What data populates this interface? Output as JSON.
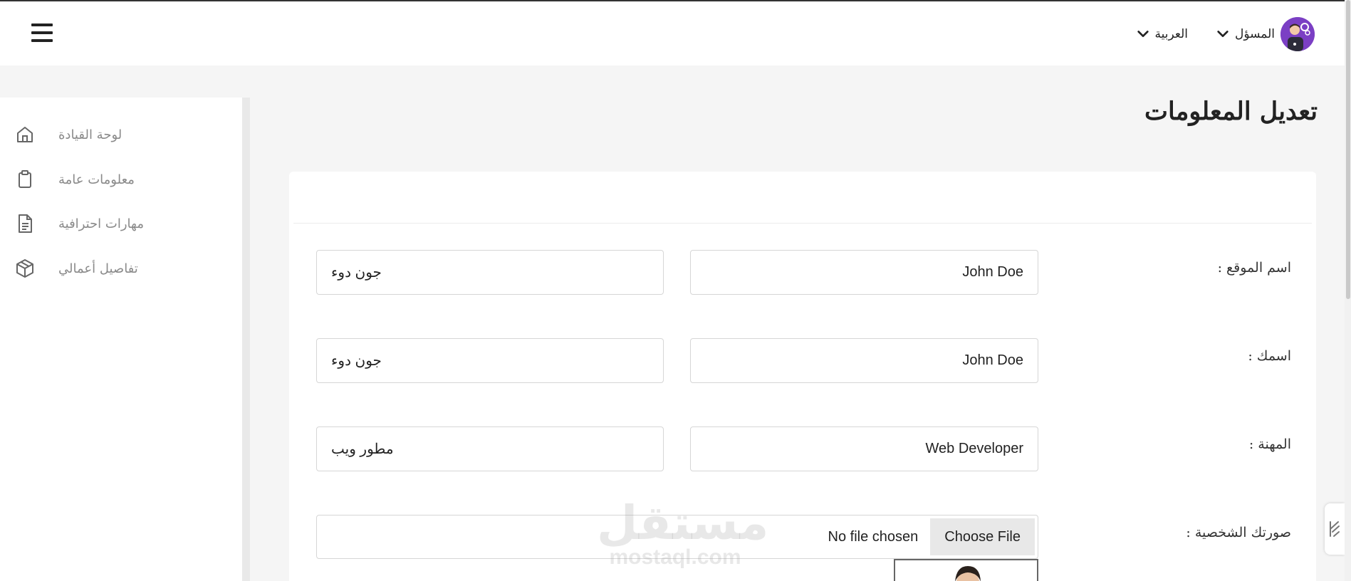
{
  "header": {
    "user_name": "المسؤل",
    "language": "العربية",
    "user_icon": "user-avatar",
    "menu_icon": "hamburger-menu-icon"
  },
  "sidebar": {
    "items": [
      {
        "label": "لوحة القيادة",
        "icon": "home-icon"
      },
      {
        "label": "معلومات عامة",
        "icon": "clipboard-icon"
      },
      {
        "label": "مهارات احترافية",
        "icon": "document-icon"
      },
      {
        "label": "تفاصيل أعمالي",
        "icon": "box-icon"
      }
    ]
  },
  "page": {
    "title": "تعديل المعلومات"
  },
  "form": {
    "site_name": {
      "label": "اسم الموقع :",
      "value_en": "John Doe",
      "value_ar": "جون دوء"
    },
    "your_name": {
      "label": "اسمك :",
      "value_en": "John Doe",
      "value_ar": "جون دوء"
    },
    "profession": {
      "label": "المهنة :",
      "value_en": "Web Developer",
      "value_ar": "مطور ويب"
    },
    "photo": {
      "label": "صورتك الشخصية :",
      "button": "Choose File",
      "status": "No file chosen"
    }
  },
  "watermark": {
    "ar": "مستقل",
    "en": "mostaql.com"
  },
  "colors": {
    "avatar_bg": "#7b3fc4",
    "sidebar_text": "#8a8a8a",
    "page_bg": "#f5f5f5"
  }
}
